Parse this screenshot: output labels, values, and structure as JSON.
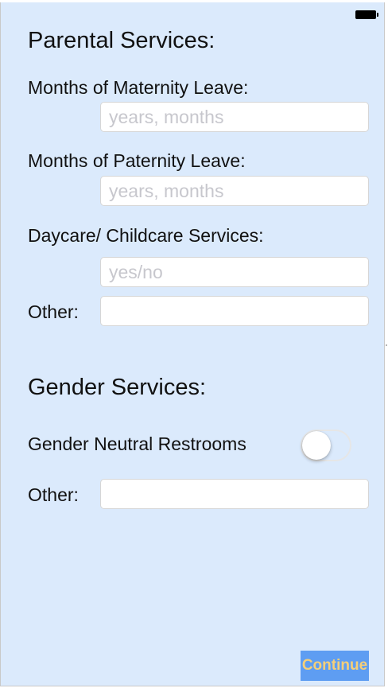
{
  "status_bar": {
    "battery_icon": "battery-full-icon"
  },
  "parental": {
    "title": "Parental Services:",
    "maternity": {
      "label": "Months of Maternity Leave:",
      "placeholder": "years, months",
      "value": ""
    },
    "paternity": {
      "label": "Months of Paternity Leave:",
      "placeholder": "years, months",
      "value": ""
    },
    "daycare": {
      "label": "Daycare/ Childcare Services:",
      "placeholder": "yes/no",
      "value": ""
    },
    "other": {
      "label": "Other:",
      "placeholder": "",
      "value": ""
    }
  },
  "gender": {
    "title": "Gender Services:",
    "restrooms": {
      "label": "Gender Neutral Restrooms",
      "enabled": false
    },
    "other": {
      "label": "Other:",
      "placeholder": "",
      "value": ""
    }
  },
  "continue_label": "Continue",
  "colors": {
    "background": "#dbeafc",
    "button_bg": "#5e9df2",
    "button_text": "#f6cf78",
    "placeholder": "#c7c7cd"
  }
}
